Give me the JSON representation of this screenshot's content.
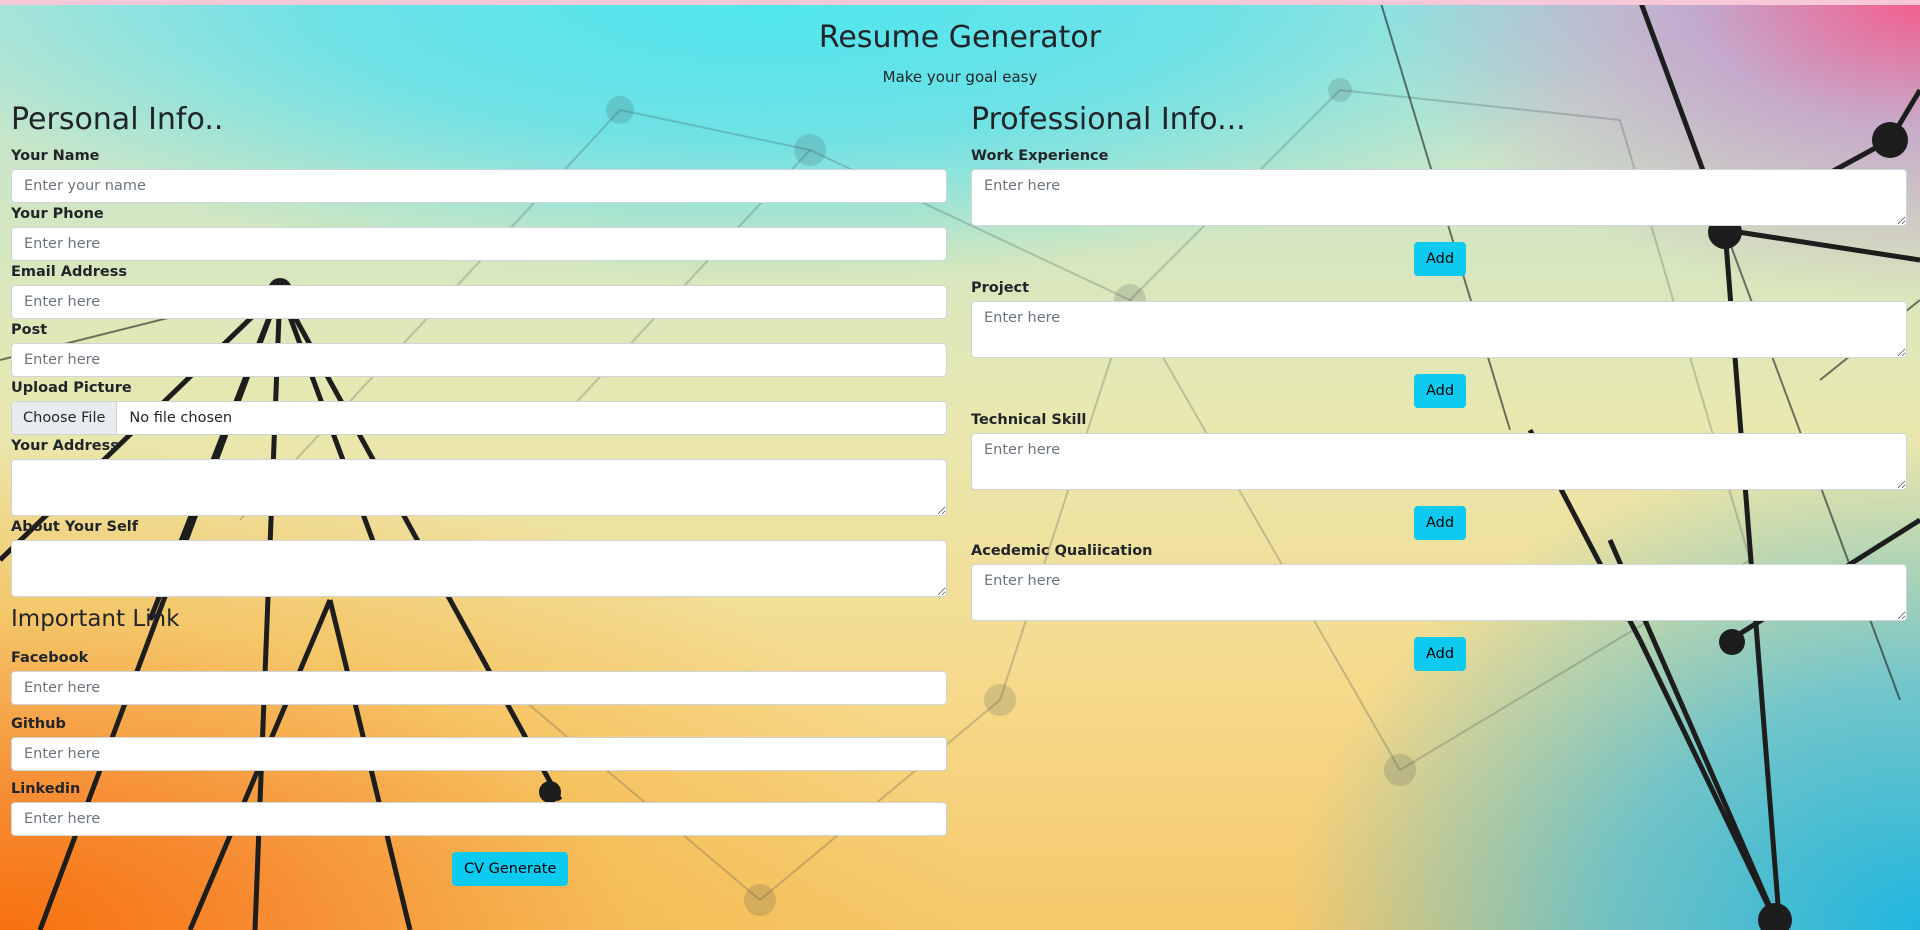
{
  "header": {
    "title": "Resume Generator",
    "subtitle": "Make your goal easy"
  },
  "personal": {
    "heading": "Personal Info..",
    "name": {
      "label": "Your Name",
      "placeholder": "Enter your name"
    },
    "phone": {
      "label": "Your Phone",
      "placeholder": "Enter here"
    },
    "email": {
      "label": "Email Address",
      "placeholder": "Enter here"
    },
    "post": {
      "label": "Post",
      "placeholder": "Enter here"
    },
    "picture": {
      "label": "Upload Picture",
      "button": "Choose File",
      "status": "No file chosen"
    },
    "address": {
      "label": "Your Address",
      "placeholder": ""
    },
    "about": {
      "label": "About Your Self",
      "placeholder": ""
    }
  },
  "links": {
    "heading": "Important Link",
    "facebook": {
      "label": "Facebook",
      "placeholder": "Enter here"
    },
    "github": {
      "label": "Github",
      "placeholder": "Enter here"
    },
    "linkedin": {
      "label": "Linkedin",
      "placeholder": "Enter here"
    },
    "generate_button": "CV Generate"
  },
  "professional": {
    "heading": "Professional Info...",
    "work": {
      "label": "Work Experience",
      "placeholder": "Enter here",
      "add": "Add"
    },
    "project": {
      "label": "Project",
      "placeholder": "Enter here",
      "add": "Add"
    },
    "skill": {
      "label": "Technical Skill",
      "placeholder": "Enter here",
      "add": "Add"
    },
    "academic": {
      "label": "Acedemic Qualiication",
      "placeholder": "Enter here",
      "add": "Add"
    }
  },
  "colors": {
    "button": "#0dcaf0",
    "text": "#212529",
    "placeholder": "#6c757d"
  }
}
